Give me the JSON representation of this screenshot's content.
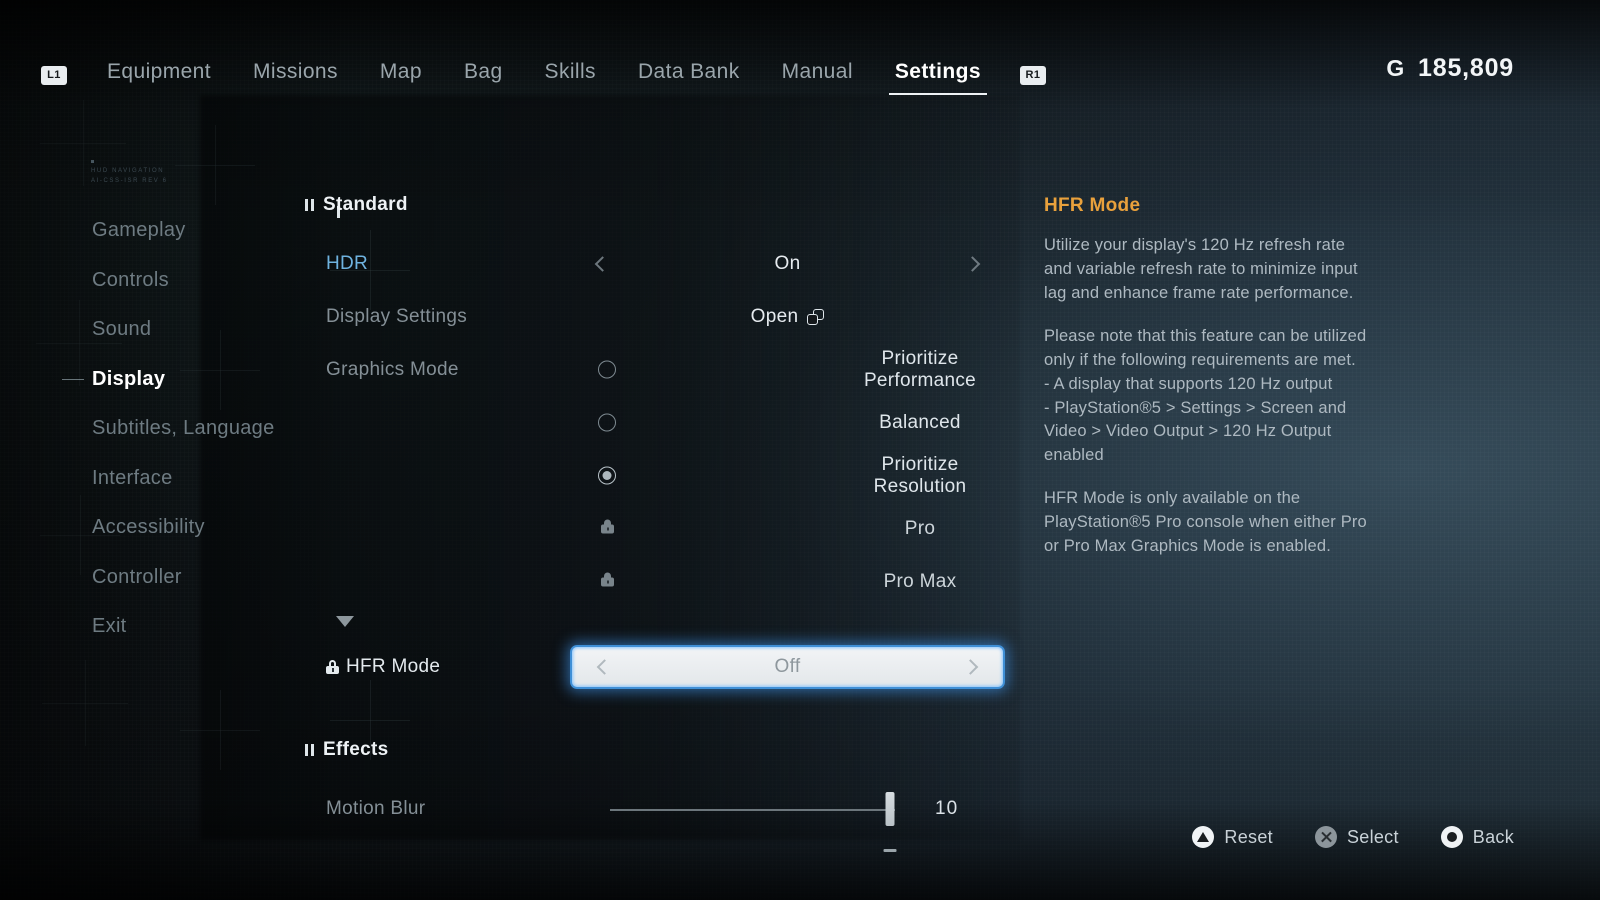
{
  "topnav": {
    "left_bumper": "L1",
    "right_bumper": "R1",
    "tabs": [
      {
        "label": "Equipment",
        "active": false
      },
      {
        "label": "Missions",
        "active": false
      },
      {
        "label": "Map",
        "active": false
      },
      {
        "label": "Bag",
        "active": false
      },
      {
        "label": "Skills",
        "active": false
      },
      {
        "label": "Data Bank",
        "active": false
      },
      {
        "label": "Manual",
        "active": false
      },
      {
        "label": "Settings",
        "active": true
      }
    ]
  },
  "currency": {
    "symbol": "G",
    "amount": "185,809"
  },
  "sidebar": {
    "hud_tag_line1": "HUD NAVIGATION",
    "hud_tag_line2": "AI-CSS-ISR REV 6",
    "items": [
      {
        "label": "Gameplay",
        "active": false
      },
      {
        "label": "Controls",
        "active": false
      },
      {
        "label": "Sound",
        "active": false
      },
      {
        "label": "Display",
        "active": true
      },
      {
        "label": "Subtitles, Language",
        "active": false
      },
      {
        "label": "Interface",
        "active": false
      },
      {
        "label": "Accessibility",
        "active": false
      },
      {
        "label": "Controller",
        "active": false
      },
      {
        "label": "Exit",
        "active": false
      }
    ]
  },
  "main": {
    "sections": [
      {
        "title": "Standard"
      },
      {
        "title": "Effects"
      }
    ],
    "standard": {
      "hdr": {
        "label": "HDR",
        "value": "On"
      },
      "display_settings": {
        "label": "Display Settings",
        "value": "Open"
      },
      "graphics_mode": {
        "label": "Graphics Mode",
        "options": [
          {
            "label": "Prioritize Performance",
            "selected": false,
            "locked": false
          },
          {
            "label": "Balanced",
            "selected": false,
            "locked": false
          },
          {
            "label": "Prioritize Resolution",
            "selected": true,
            "locked": false
          },
          {
            "label": "Pro",
            "selected": false,
            "locked": true
          },
          {
            "label": "Pro Max",
            "selected": false,
            "locked": true
          }
        ]
      },
      "hfr_mode": {
        "label": "HFR Mode",
        "value": "Off",
        "locked": true,
        "highlighted": true
      }
    },
    "effects": {
      "motion_blur": {
        "label": "Motion Blur",
        "value": "10",
        "percent": 100
      }
    }
  },
  "description": {
    "title": "HFR Mode",
    "paragraphs": [
      "Utilize your display's 120 Hz refresh rate and variable refresh rate to minimize input lag and enhance frame rate performance.",
      "Please note that this feature can be utilized only if the following requirements are met.\n- A display that supports 120 Hz output\n- PlayStation®5 > Settings > Screen and Video > Video Output > 120 Hz Output enabled",
      "HFR Mode is only available on the PlayStation®5 Pro console when either Pro or Pro Max Graphics Mode is enabled."
    ]
  },
  "footer": {
    "prompts": [
      {
        "glyph": "triangle",
        "label": "Reset"
      },
      {
        "glyph": "cross",
        "label": "Select"
      },
      {
        "glyph": "circle",
        "label": "Back"
      }
    ]
  },
  "colors": {
    "accent_orange": "#e9a13c",
    "accent_blue": "#6fb3e0",
    "highlight_border": "#3f8fd6"
  }
}
